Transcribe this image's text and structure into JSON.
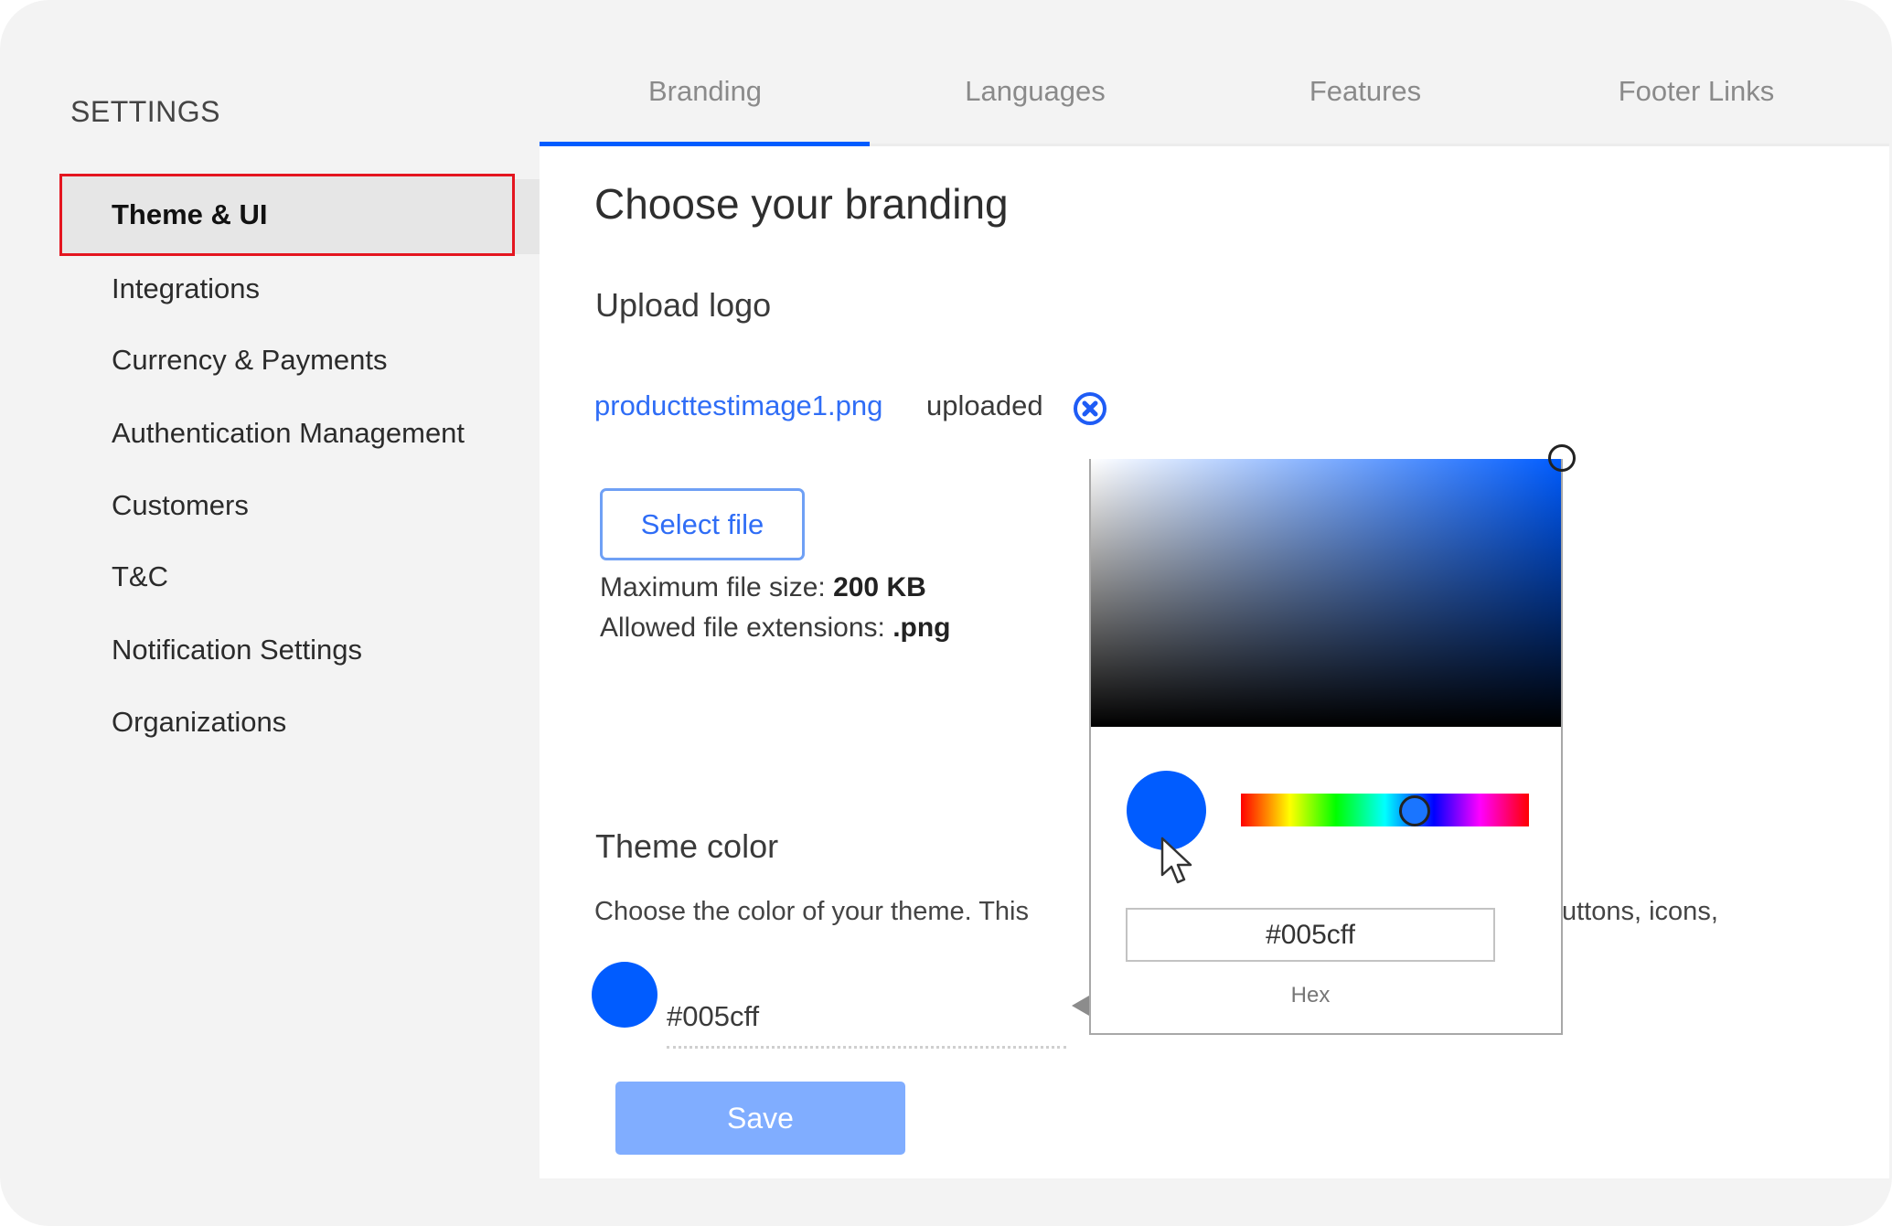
{
  "sidebar": {
    "title": "SETTINGS",
    "items": [
      {
        "label": "Theme & UI",
        "active": true
      },
      {
        "label": "Integrations"
      },
      {
        "label": "Currency & Payments"
      },
      {
        "label": "Authentication Management"
      },
      {
        "label": "Customers"
      },
      {
        "label": "T&C"
      },
      {
        "label": "Notification Settings"
      },
      {
        "label": "Organizations"
      }
    ]
  },
  "tabs": [
    {
      "label": "Branding",
      "active": true
    },
    {
      "label": "Languages"
    },
    {
      "label": "Features"
    },
    {
      "label": "Footer Links"
    }
  ],
  "branding": {
    "title": "Choose your branding",
    "upload_logo": {
      "heading": "Upload logo",
      "file_name": "producttestimage1.png",
      "status": "uploaded",
      "remove_icon": "close-circle-icon",
      "select_file_label": "Select file",
      "max_size_label": "Maximum file size:",
      "max_size_value": "200 KB",
      "extensions_label": "Allowed file extensions:",
      "extensions_value": ".png"
    },
    "theme_color": {
      "heading": "Theme color",
      "description_visible_start": "Choose the color of your theme. This",
      "description_visible_end": "uttons, icons,",
      "value": "#005cff"
    },
    "save_label": "Save"
  },
  "color_picker": {
    "hex_value": "#005cff",
    "hex_label": "Hex",
    "hue_degrees": 218,
    "saturation_percent": 100,
    "brightness_percent": 100
  },
  "colors": {
    "accent": "#005cff",
    "highlight_border": "#e4151f",
    "save_disabled": "#80adff"
  }
}
